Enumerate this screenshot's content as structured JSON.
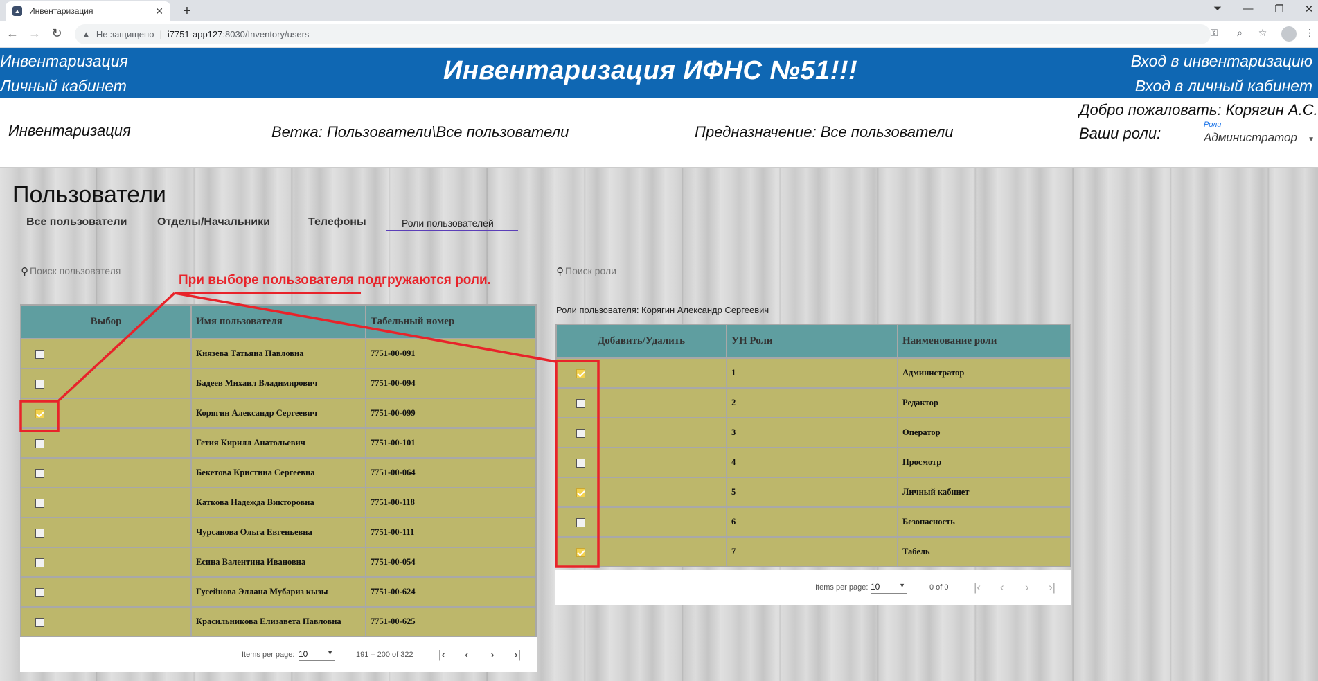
{
  "browser": {
    "tab_title": "Инвентаризация",
    "new_tab": "+",
    "security_label": "Не защищено",
    "url_host": "i7751-app127",
    "url_path": ":8030/Inventory/users"
  },
  "header": {
    "link_inventory": "Инвентаризация",
    "link_cabinet": "Личный кабинет",
    "title": "Инвентаризация ИФНС №51!!!",
    "login_inventory": "Вход в инвентаризацию",
    "login_cabinet": "Вход в личный кабинет"
  },
  "infobar": {
    "section": "Инвентаризация",
    "branch": "Ветка: Пользователи\\Все пользователи",
    "purpose": "Предназначение: Все пользователи",
    "welcome": "Добро пожаловать: Корягин А.С.",
    "roles_label": "Ваши роли:",
    "roles_select_label": "Роли",
    "roles_select_value": "Администратор"
  },
  "page": {
    "title": "Пользователи",
    "tabs": [
      "Все пользователи",
      "Отделы/Начальники",
      "Телефоны",
      "Роли пользователей"
    ],
    "active_tab": "Роли пользователей"
  },
  "users_panel": {
    "search_placeholder": "Поиск пользователя",
    "columns": [
      "Выбор",
      "Имя пользователя",
      "Табельный номер"
    ],
    "rows": [
      {
        "checked": false,
        "name": "Князева Татьяна Павловна",
        "number": "7751-00-091"
      },
      {
        "checked": false,
        "name": "Бадеев Михаил Владимирович",
        "number": "7751-00-094"
      },
      {
        "checked": true,
        "name": "Корягин Александр Сергеевич",
        "number": "7751-00-099"
      },
      {
        "checked": false,
        "name": "Гетия Кирилл Анатольевич",
        "number": "7751-00-101"
      },
      {
        "checked": false,
        "name": "Бекетова Кристина Сергеевна",
        "number": "7751-00-064"
      },
      {
        "checked": false,
        "name": "Каткова Надежда Викторовна",
        "number": "7751-00-118"
      },
      {
        "checked": false,
        "name": "Чурсанова Ольга Евгеньевна",
        "number": "7751-00-111"
      },
      {
        "checked": false,
        "name": "Есина Валентина Ивановна",
        "number": "7751-00-054"
      },
      {
        "checked": false,
        "name": "Гусейнова Эллана Мубариз кызы",
        "number": "7751-00-624"
      },
      {
        "checked": false,
        "name": "Красильникова Елизавета Павловна",
        "number": "7751-00-625"
      }
    ],
    "paginator": {
      "items_per_page_label": "Items per page:",
      "items_per_page": "10",
      "range": "191 – 200 of 322"
    }
  },
  "roles_panel": {
    "search_placeholder": "Поиск роли",
    "user_roles_label": "Роли пользователя: Корягин Александр Сергеевич",
    "columns": [
      "Добавить/Удалить",
      "УН Роли",
      "Наименование роли"
    ],
    "rows": [
      {
        "checked": true,
        "id": "1",
        "name": "Администратор"
      },
      {
        "checked": false,
        "id": "2",
        "name": "Редактор"
      },
      {
        "checked": false,
        "id": "3",
        "name": "Оператор"
      },
      {
        "checked": false,
        "id": "4",
        "name": "Просмотр"
      },
      {
        "checked": true,
        "id": "5",
        "name": "Личный кабинет"
      },
      {
        "checked": false,
        "id": "6",
        "name": "Безопасность"
      },
      {
        "checked": true,
        "id": "7",
        "name": "Табель"
      }
    ],
    "paginator": {
      "items_per_page_label": "Items per page:",
      "items_per_page": "10",
      "range": "0 of 0"
    }
  },
  "annotation": {
    "text": "При выборе пользователя подгружаются роли.",
    "color": "#e8232a"
  },
  "colors": {
    "header_blue": "#0f67b3",
    "table_header": "#5f9ea0",
    "table_cell": "#bdb76b",
    "active_tab_ink": "#5b3fb8"
  }
}
